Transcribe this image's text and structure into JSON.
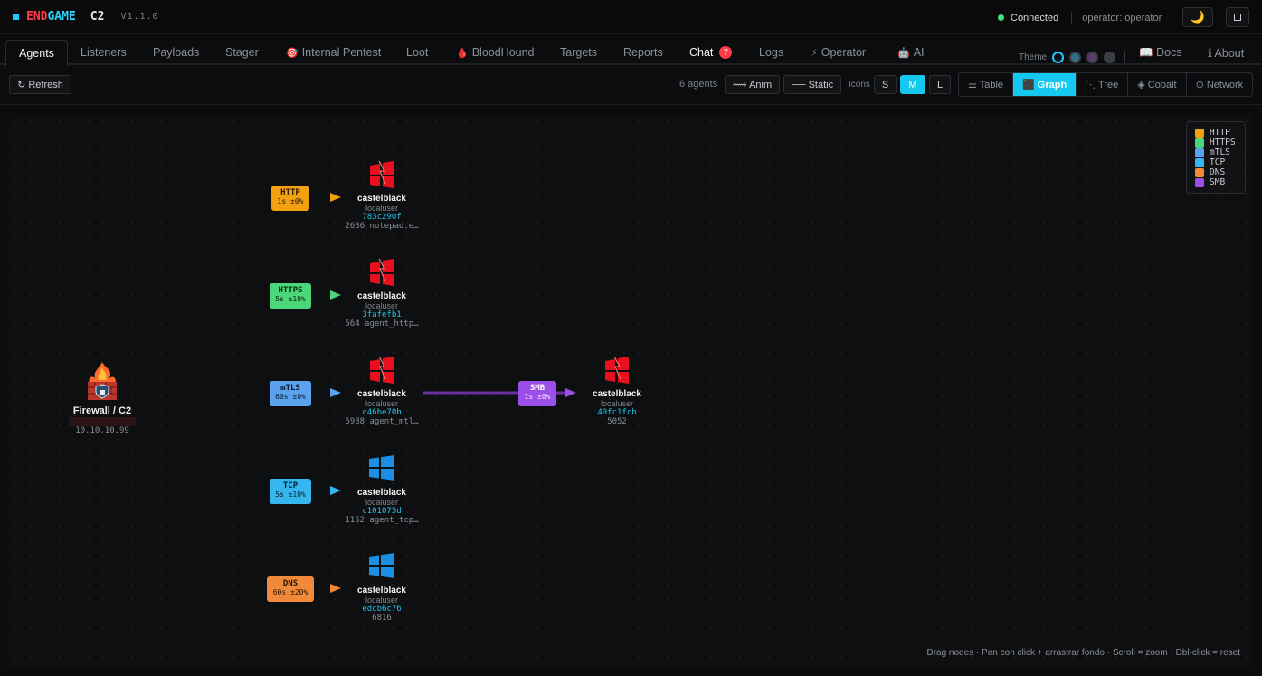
{
  "brand": {
    "end": "END",
    "game": "GAME",
    "c2": "C2",
    "version": "V1.1.0"
  },
  "status": {
    "connection": "Connected",
    "operator": "operator: operator"
  },
  "tabs": [
    {
      "label": "Agents",
      "icon": ""
    },
    {
      "label": "Listeners",
      "icon": ""
    },
    {
      "label": "Payloads",
      "icon": ""
    },
    {
      "label": "Stager",
      "icon": ""
    },
    {
      "label": "Internal Pentest",
      "icon": "🎯"
    },
    {
      "label": "Loot",
      "icon": ""
    },
    {
      "label": "BloodHound",
      "icon": "🩸"
    },
    {
      "label": "Targets",
      "icon": ""
    },
    {
      "label": "Reports",
      "icon": ""
    },
    {
      "label": "Chat",
      "icon": "",
      "badge": "7"
    },
    {
      "label": "Logs",
      "icon": ""
    },
    {
      "label": "Operator",
      "icon": "⚡"
    },
    {
      "label": "AI",
      "icon": "🤖"
    }
  ],
  "theme": {
    "label": "Theme",
    "colors": [
      "#0e0f10",
      "#2d6f8a",
      "#5b3a6b",
      "#3a3d41"
    ]
  },
  "links": {
    "docs": "📖 Docs",
    "about": "ℹ About"
  },
  "toolbar": {
    "refresh": "↻ Refresh",
    "agent_count": "6 agents",
    "anim": "⟿ Anim",
    "static": "── Static",
    "icons_label": "Icons",
    "sizes": [
      "S",
      "M",
      "L"
    ],
    "size_selected": "M",
    "views": [
      "☰ Table",
      "⬛ Graph",
      "⋱ Tree",
      "◈ Cobalt",
      "⊙ Network"
    ],
    "view_selected": "⬛ Graph"
  },
  "graph": {
    "firewall": {
      "name": "Firewall / C2",
      "ip": "10.10.10.99"
    },
    "listeners": [
      {
        "proto": "HTTP",
        "jitter": "1s ±0%",
        "color": "#f5a00f"
      },
      {
        "proto": "HTTPS",
        "jitter": "5s ±10%",
        "color": "#4cd67a"
      },
      {
        "proto": "mTLS",
        "jitter": "60s ±0%",
        "color": "#5aa2ee"
      },
      {
        "proto": "TCP",
        "jitter": "5s ±10%",
        "color": "#35b6ee"
      },
      {
        "proto": "DNS",
        "jitter": "60s ±20%",
        "color": "#f08a3a"
      }
    ],
    "agents": [
      {
        "name": "castelblack",
        "user": "localuser",
        "id": "783c290f",
        "proc": "2636 notepad.e…",
        "os": "debian"
      },
      {
        "name": "castelblack",
        "user": "localuser",
        "id": "3fafefb1",
        "proc": "564 agent_http…",
        "os": "debian"
      },
      {
        "name": "castelblack",
        "user": "localuser",
        "id": "c46be70b",
        "proc": "5988 agent_mtl…",
        "os": "debian"
      },
      {
        "name": "castelblack",
        "user": "localuser",
        "id": "c101075d",
        "proc": "1152 agent_tcp…",
        "os": "windows"
      },
      {
        "name": "castelblack",
        "user": "localuser",
        "id": "edcb6c76",
        "proc": "6816",
        "os": "windows"
      }
    ],
    "pivot": {
      "proto": "SMB",
      "jitter": "1s ±0%",
      "color": "#9b4ee8",
      "agent": {
        "name": "castelblack",
        "user": "localuser",
        "id": "49fc1fcb",
        "proc": "5052",
        "os": "debian"
      }
    }
  },
  "legend": [
    {
      "label": "HTTP",
      "color": "#f5a00f"
    },
    {
      "label": "HTTPS",
      "color": "#4cd67a"
    },
    {
      "label": "mTLS",
      "color": "#5aa2ee"
    },
    {
      "label": "TCP",
      "color": "#35b6ee"
    },
    {
      "label": "DNS",
      "color": "#f08a3a"
    },
    {
      "label": "SMB",
      "color": "#9b4ee8"
    }
  ],
  "hint": "Drag nodes · Pan con click + arrastrar fondo · Scroll = zoom · Dbl-click = reset"
}
